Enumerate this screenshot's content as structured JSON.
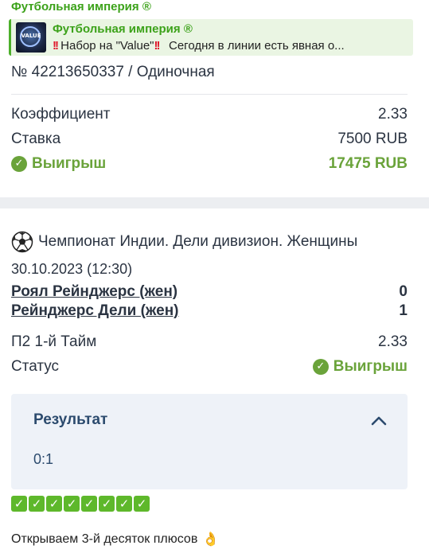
{
  "channel": {
    "name": "Футбольная империя ®"
  },
  "reply": {
    "author": "Футбольная империя ®",
    "thumb_text": "VALUE",
    "text": "Набор на \"Value\"",
    "text_rest": "Сегодня в линии есть явная о..."
  },
  "bet": {
    "ticket": "№ 42213650337 / Одиночная",
    "rows": [
      {
        "label": "Коэффициент",
        "value": "2.33"
      },
      {
        "label": "Ставка",
        "value": "7500 RUB"
      }
    ],
    "win": {
      "label": "Выигрыш",
      "value": "17475 RUB"
    }
  },
  "event": {
    "league": "Чемпионат Индии. Дели дивизион. Женщины",
    "date": "30.10.2023 (12:30)",
    "teams": [
      {
        "name": "Роял Рейнджерс (жен)",
        "score": "0"
      },
      {
        "name": "Рейнджерс Дели (жен)",
        "score": "1"
      }
    ],
    "market": {
      "label": "П2 1-й Тайм",
      "value": "2.33"
    },
    "status": {
      "label": "Статус",
      "value": "Выигрыш"
    }
  },
  "result": {
    "title": "Результат",
    "score": "0:1"
  },
  "checkmarks_count": 8,
  "footer": {
    "text": "Открываем 3-й десяток плюсов"
  },
  "colors": {
    "accent_green": "#3ca21a",
    "win_green": "#6aa33a",
    "result_blue": "#2c4b6e"
  }
}
